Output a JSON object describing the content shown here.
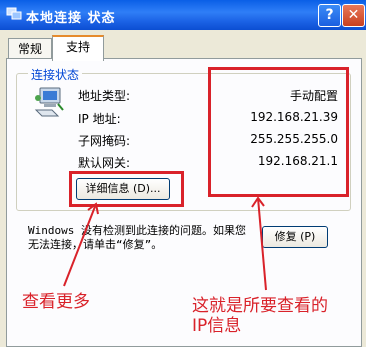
{
  "window": {
    "title": "本地连接 状态",
    "help_label": "?",
    "close_label": "✕"
  },
  "tabs": [
    {
      "label": "常规"
    },
    {
      "label": "支持"
    }
  ],
  "group": {
    "title": "连接状态"
  },
  "fields": [
    {
      "label": "地址类型:",
      "value": "手动配置"
    },
    {
      "label": "IP 地址:",
      "value": "192.168.21.39"
    },
    {
      "label": "子网掩码:",
      "value": "255.255.255.0"
    },
    {
      "label": "默认网关:",
      "value": "192.168.21.1"
    }
  ],
  "details_button": "详细信息 (D)...",
  "message": "Windows 没有检测到此连接的问题。如果您无法连接，请单击“修复”。",
  "repair_button": "修复 (P)",
  "annotations": {
    "see_more": "查看更多",
    "ip_info_line1": "这就是所要查看的",
    "ip_info_line2": "IP信息"
  },
  "colors": {
    "annotation": "#d9222a",
    "titlebar": "#0a5fe6",
    "group_title": "#0046d5"
  },
  "icons": {
    "window_icon": "network-connection-icon",
    "status_icon": "network-computer-icon"
  }
}
